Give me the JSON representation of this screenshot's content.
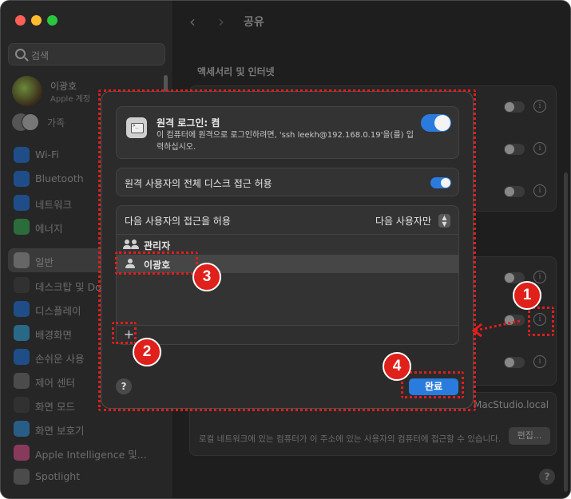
{
  "window": {
    "title": "공유",
    "nav_back": "‹",
    "nav_forward": "›"
  },
  "sidebar": {
    "search_placeholder": "검색",
    "account": {
      "name": "이광호",
      "subtitle": "Apple 계정"
    },
    "family": "가족",
    "items": [
      {
        "label": "Wi-Fi",
        "icon": "wifi-icon",
        "color": "#1a6ed8"
      },
      {
        "label": "Bluetooth",
        "icon": "bluetooth-icon",
        "color": "#1a6ed8"
      },
      {
        "label": "네트워크",
        "icon": "globe-icon",
        "color": "#1a6ed8"
      },
      {
        "label": "에너지",
        "icon": "battery-icon",
        "color": "#2fa84a"
      },
      {
        "label": "일반",
        "icon": "gear-icon",
        "color": "#8a8a8a"
      },
      {
        "label": "데스크탑 및 Dock",
        "icon": "dock-icon",
        "color": "#3a3a3a"
      },
      {
        "label": "디스플레이",
        "icon": "sun-icon",
        "color": "#1a6ed8"
      },
      {
        "label": "배경화면",
        "icon": "wallpaper-icon",
        "color": "#2aa0d8"
      },
      {
        "label": "손쉬운 사용",
        "icon": "accessibility-icon",
        "color": "#1a6ed8"
      },
      {
        "label": "제어 센터",
        "icon": "control-center-icon",
        "color": "#6a6a6a"
      },
      {
        "label": "화면 모드",
        "icon": "appearance-icon",
        "color": "#3a3a3a"
      },
      {
        "label": "화면 보호기",
        "icon": "screensaver-icon",
        "color": "#2a8ad8"
      },
      {
        "label": "Apple Intelligence 및...",
        "icon": "apple-intelligence-icon",
        "color": "#d84a8a"
      },
      {
        "label": "Spotlight",
        "icon": "spotlight-icon",
        "color": "#6a6a6a"
      }
    ]
  },
  "main": {
    "section_title": "액세서리 및 인터넷",
    "hostname": "MacStudio.local",
    "bottom_note": "로컬 네트워크에 있는 컴퓨터가 이 주소에 있는 사용자의 컴퓨터에 접근할 수 있습니다.",
    "edit_label": "편집...",
    "help_label": "?"
  },
  "sheet": {
    "remote_login": {
      "title": "원격 로그인: 켬",
      "description": "이 컴퓨터에 원격으로 로그인하려면, 'ssh leekh@192.168.0.19'을(를) 입력하십시오.",
      "enabled": true
    },
    "full_disk": {
      "label": "원격 사용자의 전체 디스크 접근 허용",
      "enabled": true
    },
    "access": {
      "label": "다음 사용자의 접근을 허용",
      "value": "다음 사용자만",
      "users": [
        {
          "name": "관리자",
          "icon": "group-icon",
          "selected": false
        },
        {
          "name": "이광호",
          "icon": "person-icon",
          "selected": true
        }
      ],
      "add_label": "+"
    },
    "help_label": "?",
    "done_label": "완료"
  },
  "annotations": {
    "markers": [
      "1",
      "2",
      "3",
      "4"
    ],
    "color": "#e21d1d"
  }
}
